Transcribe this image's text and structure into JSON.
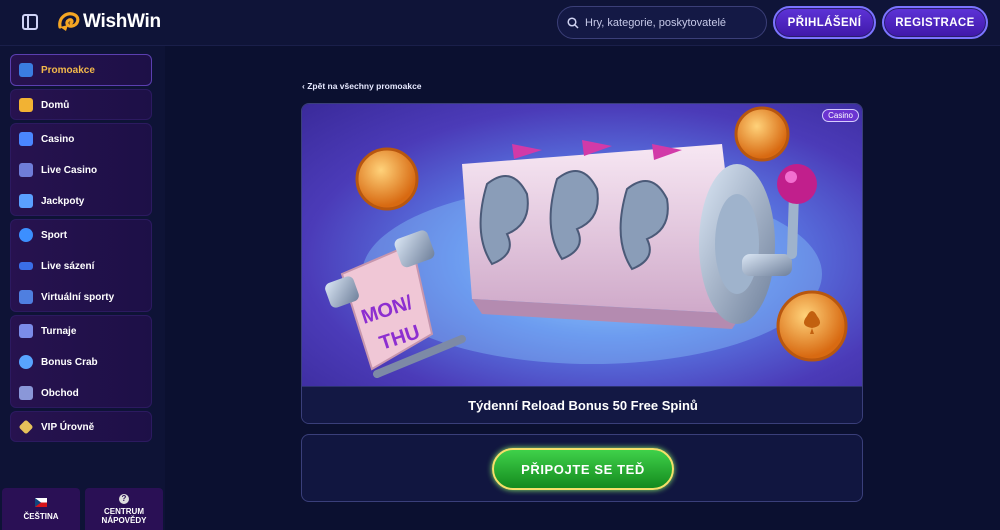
{
  "header": {
    "brand": "WishWin",
    "search_placeholder": "Hry, kategorie, poskytovatelé",
    "login_label": "PŘIHLÁŠENÍ",
    "register_label": "REGISTRACE"
  },
  "sidebar": {
    "groups": [
      {
        "items": [
          {
            "label": "Promoakce",
            "icon": "gift-icon",
            "active": true
          }
        ]
      },
      {
        "items": [
          {
            "label": "Domů",
            "icon": "home-icon"
          }
        ]
      },
      {
        "items": [
          {
            "label": "Casino",
            "icon": "slot-icon"
          },
          {
            "label": "Live Casino",
            "icon": "cards-icon"
          },
          {
            "label": "Jackpoty",
            "icon": "clover-icon"
          }
        ]
      },
      {
        "items": [
          {
            "label": "Sport",
            "icon": "ball-icon"
          },
          {
            "label": "Live sázení",
            "icon": "live-icon"
          },
          {
            "label": "Virtuální sporty",
            "icon": "virtual-icon"
          }
        ]
      },
      {
        "items": [
          {
            "label": "Turnaje",
            "icon": "trophy-icon"
          },
          {
            "label": "Bonus Crab",
            "icon": "crab-icon"
          },
          {
            "label": "Obchod",
            "icon": "basket-icon"
          }
        ]
      },
      {
        "items": [
          {
            "label": "VIP Úrovně",
            "icon": "diamond-icon"
          }
        ]
      }
    ],
    "language_label": "ČEŠTINA",
    "help_label_1": "CENTRUM",
    "help_label_2": "NÁPOVĚDY"
  },
  "main": {
    "back_label": "Zpět na všechny promoakce",
    "promo": {
      "tag": "Casino",
      "scroll_text_1": "MON/",
      "scroll_text_2": "THU",
      "title": "Týdenní Reload Bonus 50 Free Spinů"
    },
    "join_label": "PŘIPOJTE SE TEĎ"
  },
  "colors": {
    "background": "#0b1030",
    "accent_purple": "#5e33d8",
    "active_gold": "#f3b94a",
    "join_green": "#2fbf3a"
  }
}
